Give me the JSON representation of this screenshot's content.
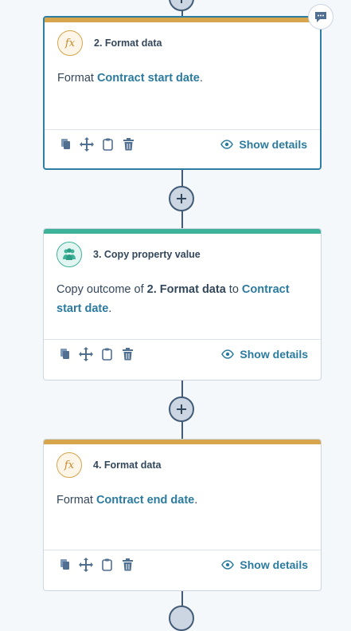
{
  "colors": {
    "connector": "#425b76",
    "format_accent": "#d6a54c",
    "copy_accent": "#3fb39a",
    "link": "#2b7a9f",
    "selected_border": "#2e7da3"
  },
  "actions": [
    {
      "title": "2. Format data",
      "icon": "fx-icon",
      "icon_text": "fx",
      "body": {
        "prefix": "Format ",
        "link": "Contract start date",
        "suffix": "."
      },
      "show_details": "Show details"
    },
    {
      "title": "3. Copy property value",
      "icon": "copy-property-icon",
      "body": {
        "prefix": "Copy outcome of ",
        "bold": "2. Format data",
        "middle": " to ",
        "link": "Contract start date",
        "suffix": "."
      },
      "show_details": "Show details"
    },
    {
      "title": "4. Format data",
      "icon": "fx-icon",
      "icon_text": "fx",
      "body": {
        "prefix": "Format ",
        "link": "Contract end date",
        "suffix": "."
      },
      "show_details": "Show details"
    }
  ]
}
